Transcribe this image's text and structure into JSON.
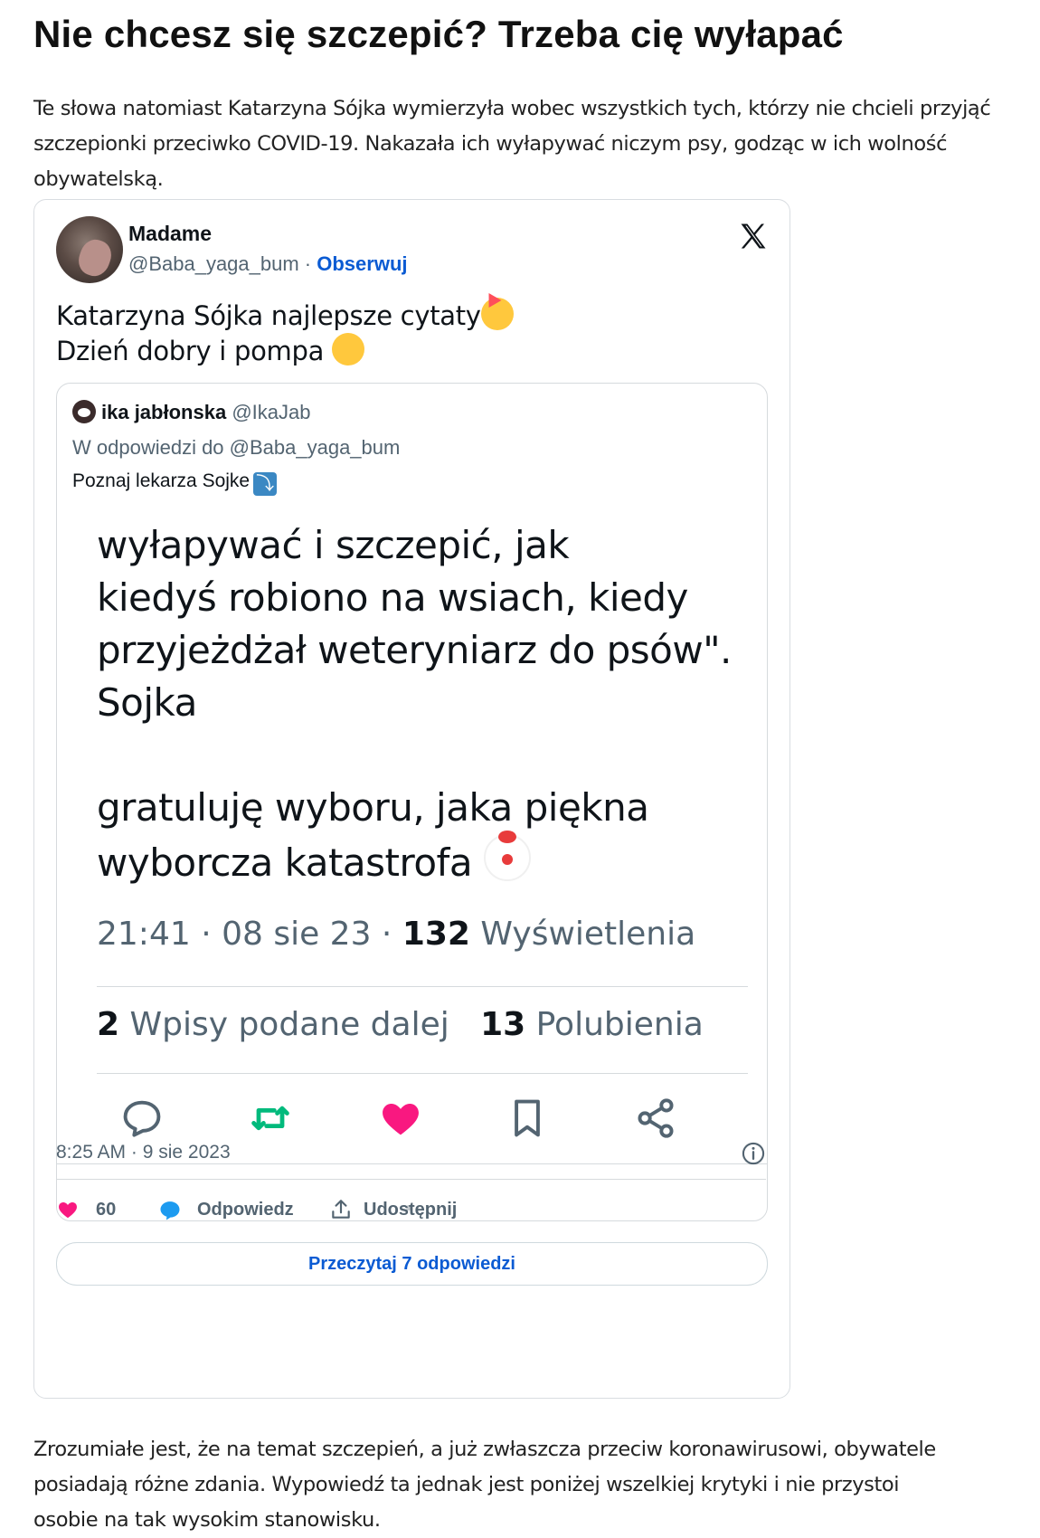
{
  "article": {
    "headline": "Nie chcesz się szczepić? Trzeba cię wyłapać",
    "paragraph1": "Te słowa natomiast Katarzyna Sójka wymierzyła wobec wszystkich tych, którzy nie chcieli przyjąć szczepionki przeciwko COVID-19. Nakazała ich wyłapywać niczym psy, godząc w ich wolność obywatelską.",
    "paragraph2": "Zrozumiałe jest, że na temat szczepień, a już zwłaszcza przeciw koronawirusowi, obywatele posiadają różne zdania. Wypowiedź ta jednak jest poniżej wszelkiej krytyki i nie przystoi osobie na tak wysokim stanowisku."
  },
  "tweet": {
    "author_name": "Madame",
    "author_handle": "@Baba_yaga_bum",
    "separator": " · ",
    "follow_label": "Obserwuj",
    "text_line1": "Katarzyna Sójka najlepsze cytaty",
    "text_line2": "Dzień dobry i pompa ",
    "timestamp": "8:25 AM · 9 sie 2023",
    "likes_count": "60",
    "reply_label": "Odpowiedz",
    "share_label": "Udostępnij",
    "read_replies_label": "Przeczytaj 7 odpowiedzi",
    "quoted": {
      "name": "ika jabłonska",
      "handle": "@IkaJab",
      "reply_to": "W odpowiedzi do @Baba_yaga_bum",
      "intro": "Poznaj lekarza Sojke",
      "body_line1": "wyłapywać i szczepić, jak",
      "body_line2": "kiedyś robiono na wsiach, kiedy",
      "body_line3": "przyjeżdżał weteryniarz do psów\".",
      "body_line4": "Sojka",
      "body_line5": "gratuluję wyboru, jaka piękna",
      "body_line6": "wyborcza katastrofa ",
      "meta_time": "21:41 · 08 sie 23 · ",
      "views_count": "132",
      "views_label": " Wyświetlenia",
      "retweets_count": "2",
      "retweets_label": " Wpisy podane dalej",
      "likes_count": "13",
      "likes_label": " Polubienia"
    }
  },
  "colors": {
    "link_blue": "#0b5bd3",
    "like_pink": "#f91880",
    "retweet_green": "#00ba7c",
    "muted_gray": "#536471"
  },
  "icons": [
    "x-logo-icon",
    "party-face-icon",
    "yawn-face-icon",
    "clown-icon",
    "arrow-down-right-icon",
    "reply-icon",
    "retweet-icon",
    "heart-icon",
    "bookmark-icon",
    "share-icon",
    "info-icon",
    "upload-icon",
    "speech-bubble-icon"
  ]
}
